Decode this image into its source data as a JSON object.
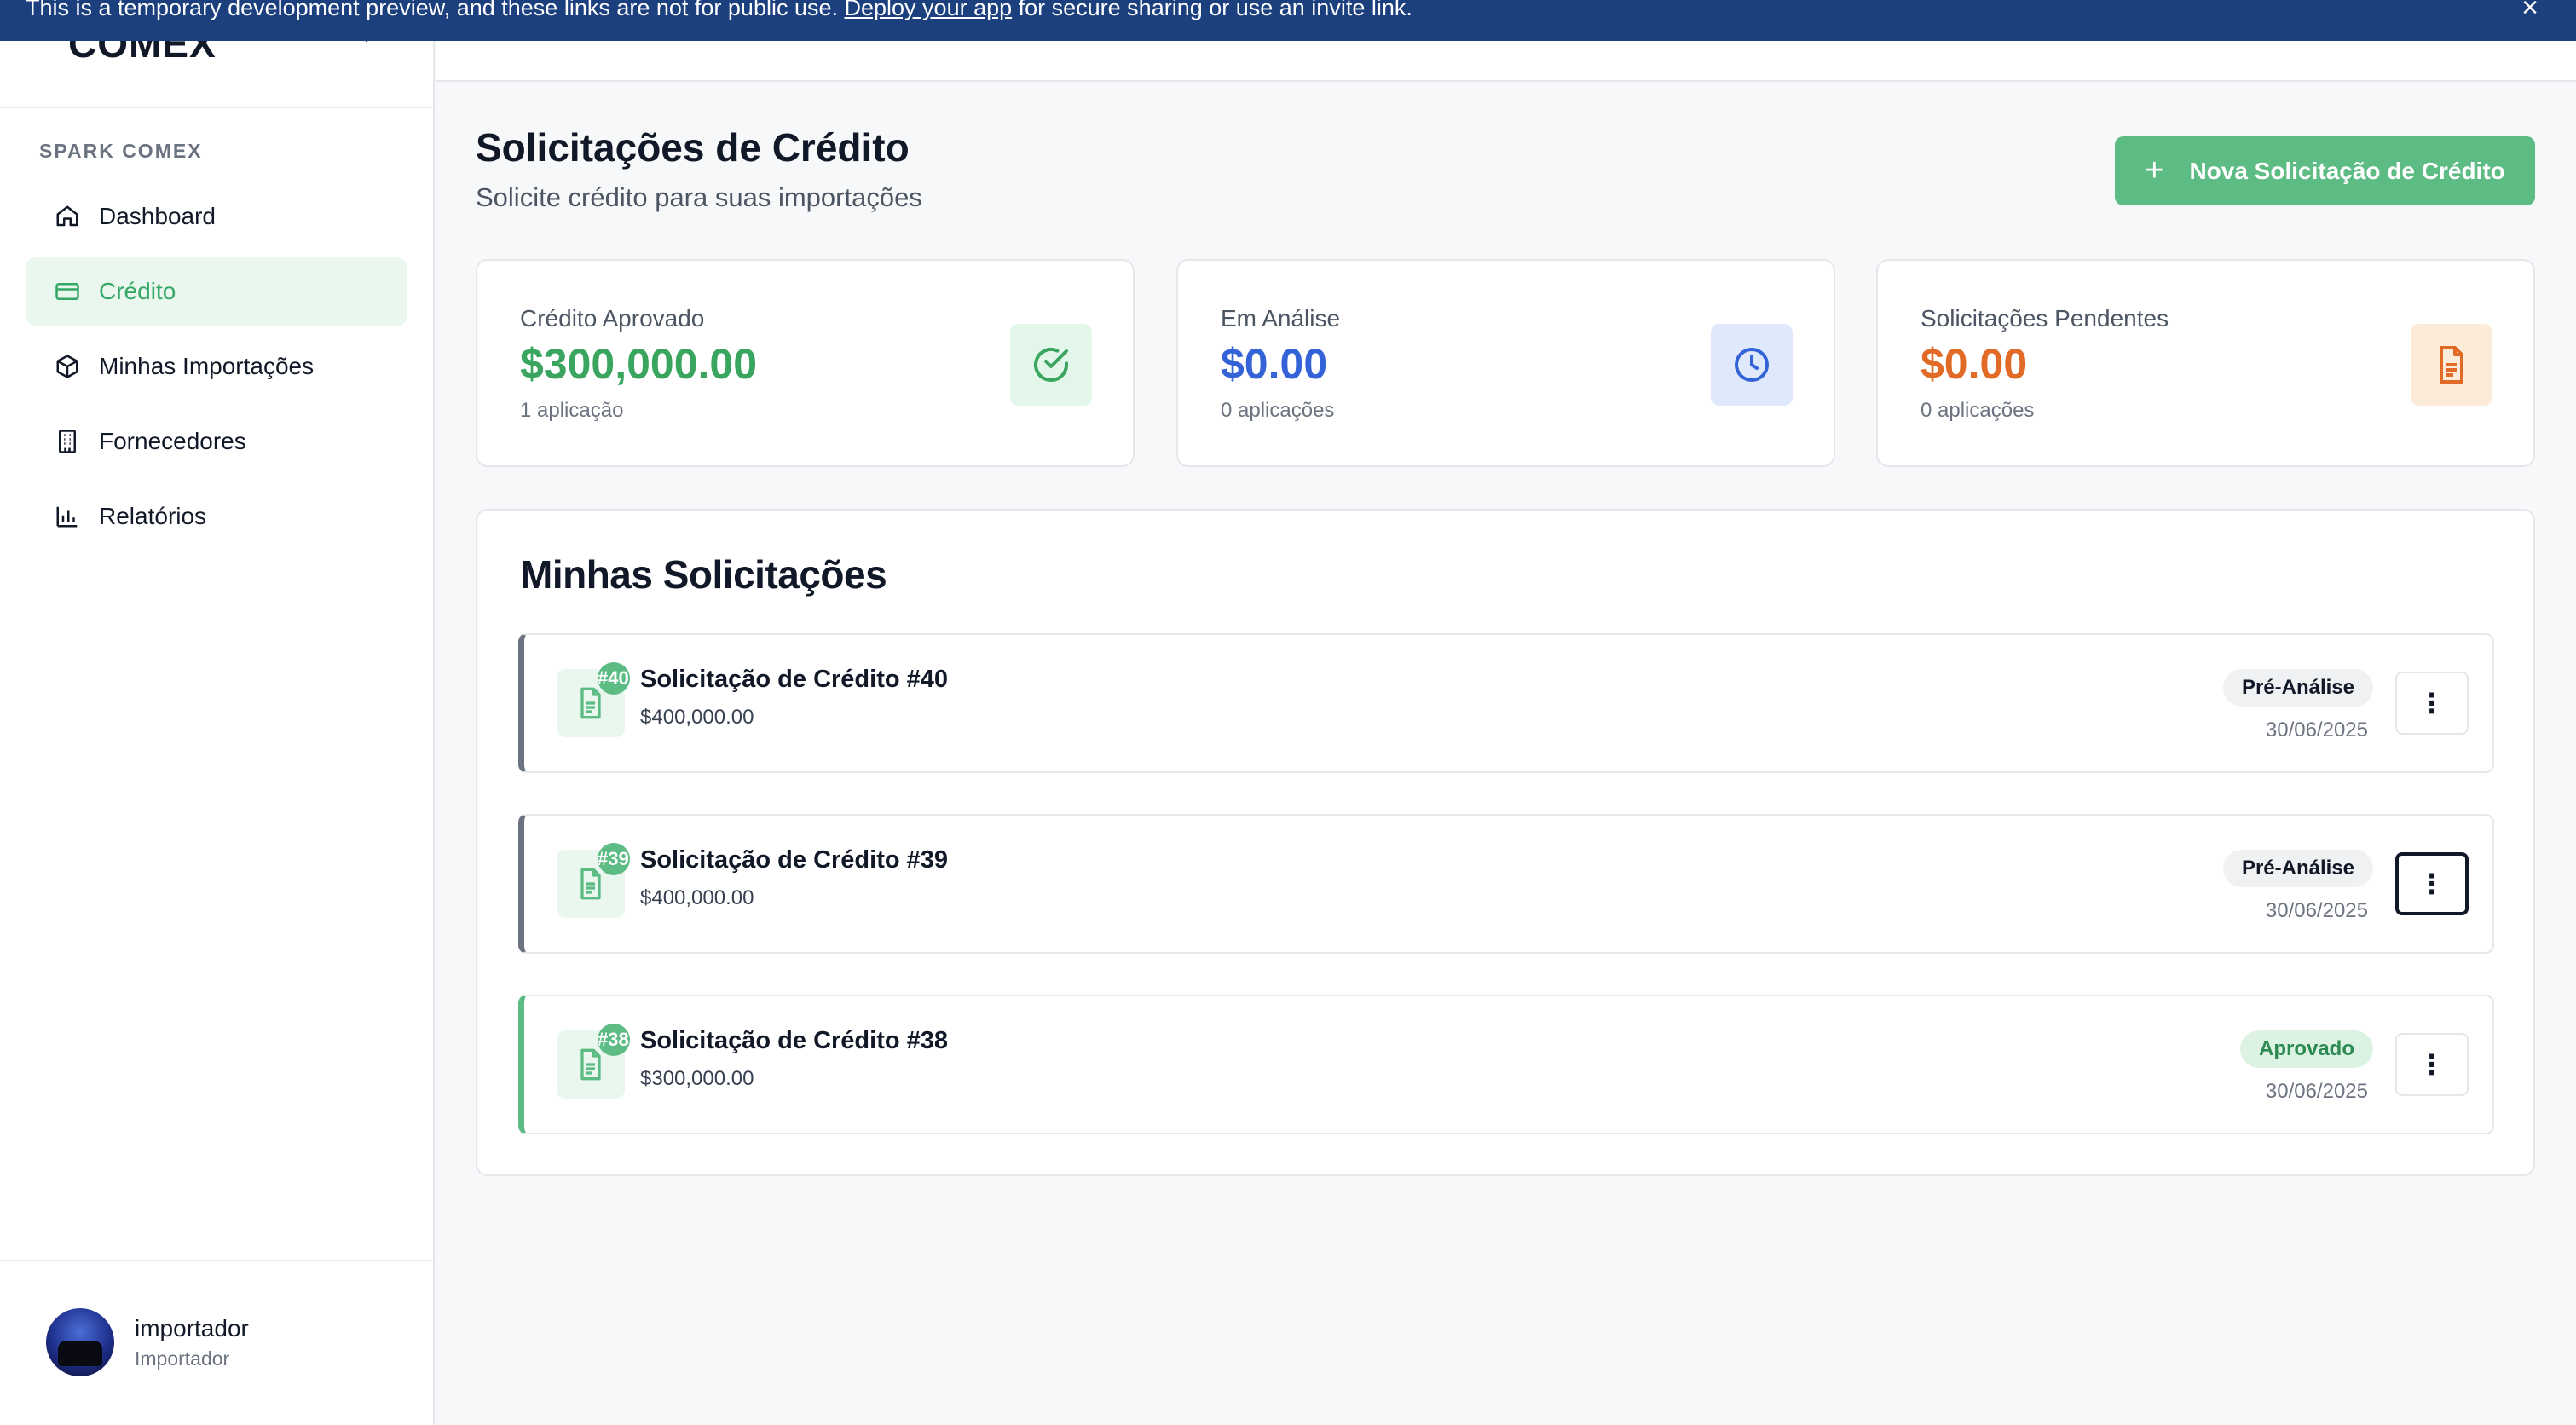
{
  "banner": {
    "text_before": "This is a temporary development preview, and these links are not for public use. ",
    "link": "Deploy your app",
    "text_after": " for secure sharing or use an invite link."
  },
  "sidebar": {
    "logo": "COMEX",
    "section_label": "SPARK COMEX",
    "items": [
      {
        "label": "Dashboard",
        "icon": "home-icon"
      },
      {
        "label": "Crédito",
        "icon": "credit-card-icon",
        "active": true
      },
      {
        "label": "Minhas Importações",
        "icon": "package-icon"
      },
      {
        "label": "Fornecedores",
        "icon": "building-icon"
      },
      {
        "label": "Relatórios",
        "icon": "bar-chart-icon"
      }
    ],
    "user": {
      "name": "importador",
      "role": "Importador"
    }
  },
  "header": {
    "title": "Solicitações de Crédito",
    "subtitle": "Solicite crédito para suas importações",
    "new_button": "Nova Solicitação de Crédito"
  },
  "stats": [
    {
      "label": "Crédito Aprovado",
      "value": "$300,000.00",
      "sub": "1 aplicação",
      "color": "#3aa55f",
      "icon": "check-circle-icon"
    },
    {
      "label": "Em Análise",
      "value": "$0.00",
      "sub": "0 aplicações",
      "color": "#3363d6",
      "icon": "clock-icon"
    },
    {
      "label": "Solicitações Pendentes",
      "value": "$0.00",
      "sub": "0 aplicações",
      "color": "#e06a26",
      "icon": "file-text-icon"
    }
  ],
  "requests": {
    "title": "Minhas Solicitações",
    "items": [
      {
        "badge": "#40",
        "title": "Solicitação de Crédito #40",
        "amount": "$400,000.00",
        "status": "Pré-Análise",
        "date": "30/06/2025"
      },
      {
        "badge": "#39",
        "title": "Solicitação de Crédito #39",
        "amount": "$400,000.00",
        "status": "Pré-Análise",
        "date": "30/06/2025"
      },
      {
        "badge": "#38",
        "title": "Solicitação de Crédito #38",
        "amount": "$300,000.00",
        "status": "Aprovado",
        "date": "30/06/2025"
      }
    ],
    "menu_glyph": "⋮"
  }
}
